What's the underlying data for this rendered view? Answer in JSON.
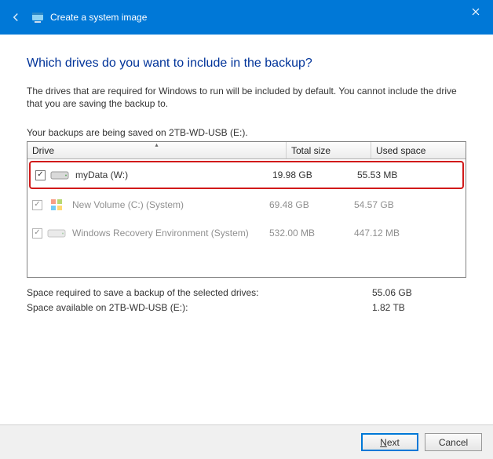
{
  "titlebar": {
    "title": "Create a system image"
  },
  "heading": "Which drives do you want to include in the backup?",
  "body_text": "The drives that are required for Windows to run will be included by default. You cannot include the drive that you are saving the backup to.",
  "save_location_text": "Your backups are being saved on 2TB-WD-USB (E:).",
  "columns": {
    "drive": "Drive",
    "total": "Total size",
    "used": "Used space"
  },
  "rows": [
    {
      "name": "myData (W:)",
      "total": "19.98 GB",
      "used": "55.53 MB",
      "checked": true,
      "locked": false,
      "highlight": true,
      "icon": "hdd"
    },
    {
      "name": "New Volume (C:) (System)",
      "total": "69.48 GB",
      "used": "54.57 GB",
      "checked": true,
      "locked": true,
      "highlight": false,
      "icon": "win"
    },
    {
      "name": "Windows Recovery Environment (System)",
      "total": "532.00 MB",
      "used": "447.12 MB",
      "checked": true,
      "locked": true,
      "highlight": false,
      "icon": "hdd"
    }
  ],
  "summary": {
    "space_required_label": "Space required to save a backup of the selected drives:",
    "space_required_value": "55.06 GB",
    "space_available_label": "Space available on 2TB-WD-USB (E:):",
    "space_available_value": "1.82 TB"
  },
  "buttons": {
    "next_prefix": "N",
    "next_rest": "ext",
    "cancel": "Cancel"
  }
}
